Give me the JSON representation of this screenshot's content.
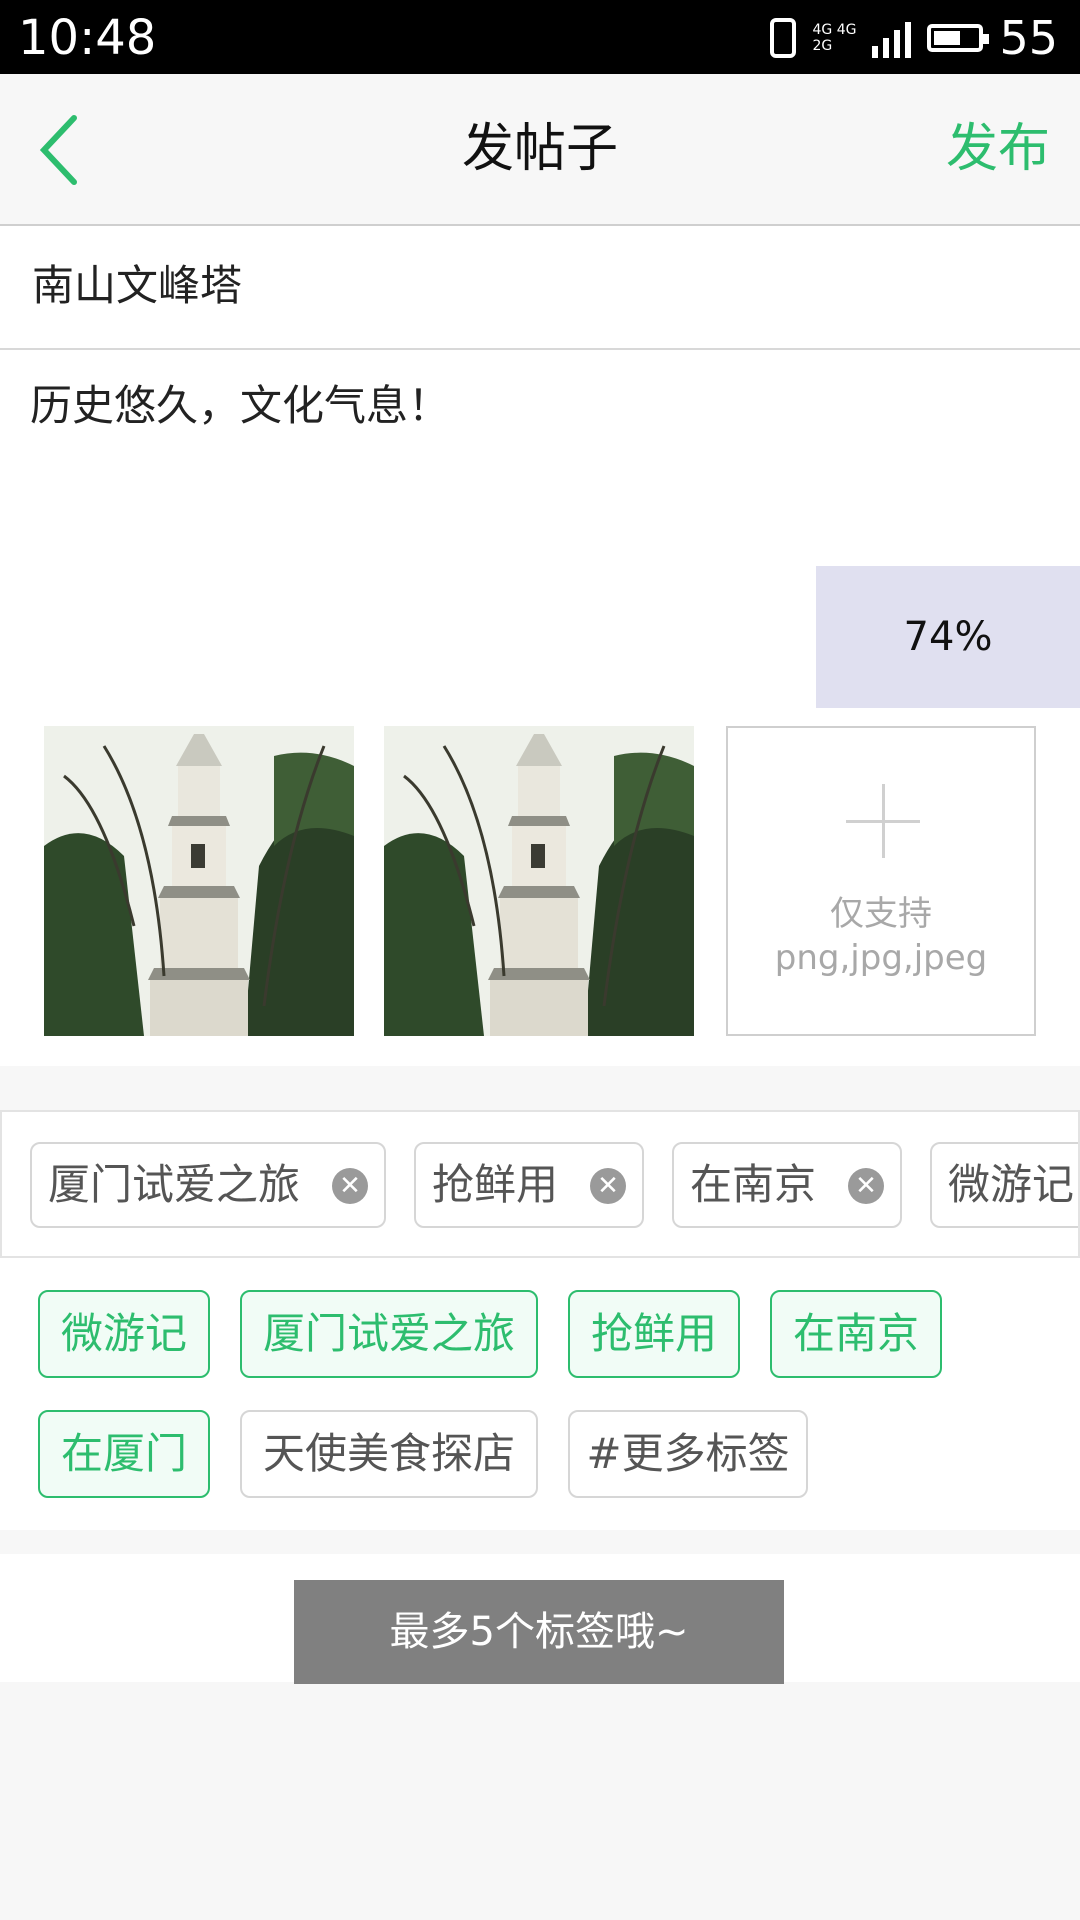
{
  "status_bar": {
    "time": "10:48",
    "battery": "55",
    "network_top": "4G 4G",
    "network_bottom": "2G"
  },
  "header": {
    "title": "发帖子",
    "publish_label": "发布"
  },
  "post": {
    "title": "南山文峰塔",
    "body": "历史悠久，文化气息！"
  },
  "upload": {
    "progress_text": "74%",
    "progress": 0.74
  },
  "add_photo": {
    "hint_line1": "仅支持",
    "hint_line2": "png,jpg,jpeg"
  },
  "selected_tags": [
    "厦门试爱之旅",
    "抢鲜用",
    "在南京",
    "微游记"
  ],
  "suggested_tags": [
    {
      "label": "微游记",
      "selected": true
    },
    {
      "label": "厦门试爱之旅",
      "selected": true
    },
    {
      "label": "抢鲜用",
      "selected": true
    },
    {
      "label": "在南京",
      "selected": true
    },
    {
      "label": "在厦门",
      "selected": true
    },
    {
      "label": "天使美食探店",
      "selected": false
    },
    {
      "label": "#更多标签",
      "selected": false
    }
  ],
  "toast": "最多5个标签哦~",
  "colors": {
    "accent": "#2dbd6e",
    "progress_bg": "#e0e0f0",
    "toast_bg": "#808080"
  }
}
